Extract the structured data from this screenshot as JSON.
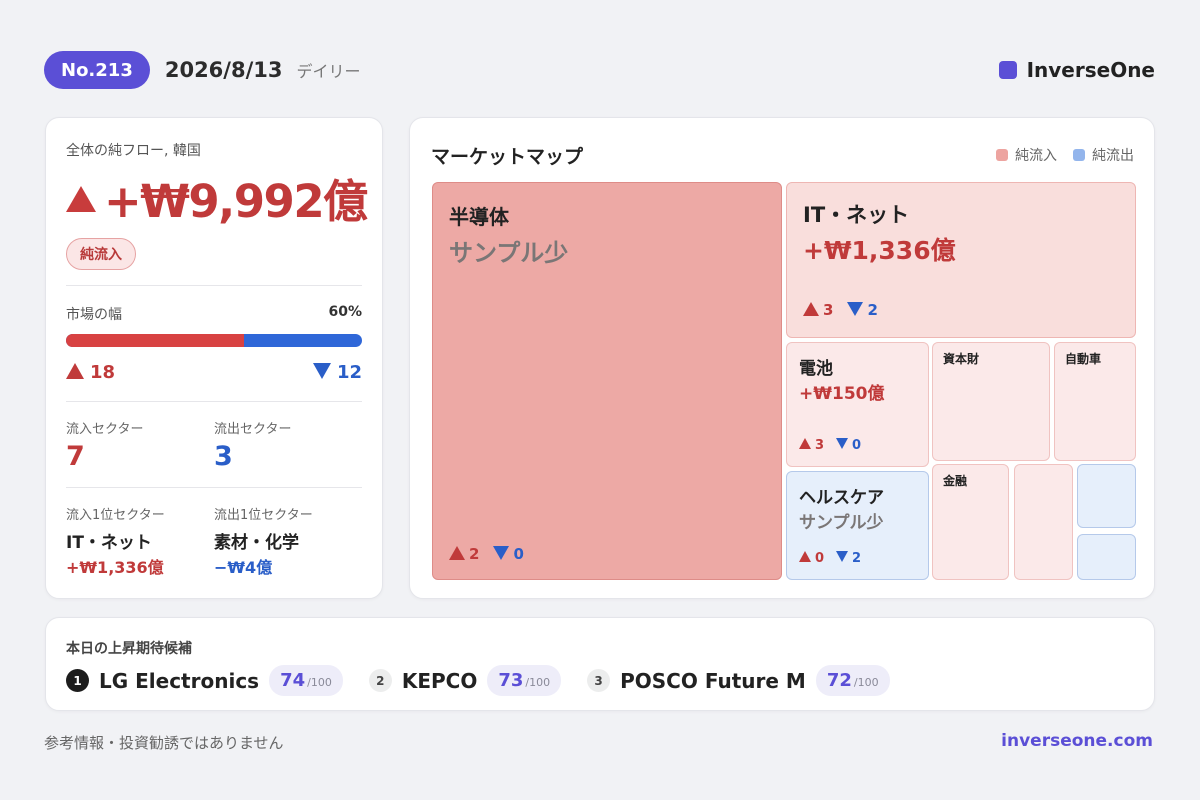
{
  "header": {
    "issue": "No.213",
    "date": "2026/8/13",
    "frequency": "デイリー",
    "brand": "InverseOne"
  },
  "summary": {
    "net_flow_label": "全体の純フロー, 韓国",
    "net_flow_value": "+₩9,992億",
    "flow_pill": "純流入",
    "breadth_label": "市場の幅",
    "breadth_pct": "60%",
    "breadth_fraction": 0.6,
    "advancers": "18",
    "decliners": "12",
    "inflow_sectors_label": "流入セクター",
    "inflow_sectors": "7",
    "outflow_sectors_label": "流出セクター",
    "outflow_sectors": "3",
    "top_inflow_label": "流入1位セクター",
    "top_inflow_name": "IT・ネット",
    "top_inflow_value": "+₩1,336億",
    "top_outflow_label": "流出1位セクター",
    "top_outflow_name": "素材・化学",
    "top_outflow_value": "−₩4億"
  },
  "market_map": {
    "title": "マーケットマップ",
    "legend": [
      {
        "label": "純流入",
        "color": "#eda4a0"
      },
      {
        "label": "純流出",
        "color": "#93b5ec"
      }
    ],
    "tiles": [
      {
        "name": "半導体",
        "value": "サンプル少",
        "up": "2",
        "down": "0"
      },
      {
        "name": "IT・ネット",
        "value": "+₩1,336億",
        "up": "3",
        "down": "2"
      },
      {
        "name": "電池",
        "value": "+₩150億",
        "up": "3",
        "down": "0"
      },
      {
        "name": "資本財"
      },
      {
        "name": "自動車"
      },
      {
        "name": "ヘルスケア",
        "value": "サンプル少",
        "up": "0",
        "down": "2"
      },
      {
        "name": "金融"
      }
    ]
  },
  "picks": {
    "title": "本日の上昇期待候補",
    "items": [
      {
        "rank": "1",
        "name": "LG Electronics",
        "score": "74",
        "max": "/100"
      },
      {
        "rank": "2",
        "name": "KEPCO",
        "score": "73",
        "max": "/100"
      },
      {
        "rank": "3",
        "name": "POSCO Future M",
        "score": "72",
        "max": "/100"
      }
    ]
  },
  "footer": {
    "disclaimer": "参考情報・投資勧誘ではありません",
    "site": "inverseone.com"
  }
}
